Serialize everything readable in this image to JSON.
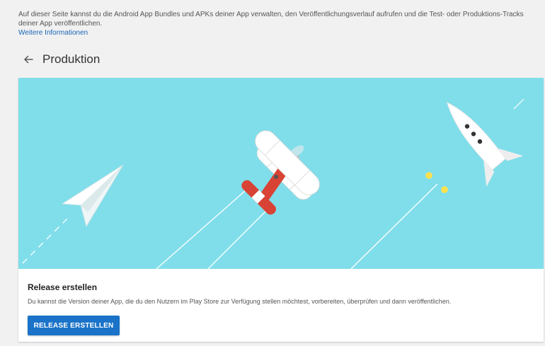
{
  "intro": {
    "text": "Auf dieser Seite kannst du die Android App Bundles und APKs deiner App verwalten, den Veröffentlichungsverlauf aufrufen und die Test- oder Produktions-Tracks deiner App veröffentlichen.",
    "link_label": "Weitere Informationen"
  },
  "header": {
    "back_icon": "arrow-left-icon",
    "title": "Produktion"
  },
  "card": {
    "illustration_icons": [
      "paper-plane-icon",
      "biplane-icon",
      "rocket-icon"
    ],
    "title": "Release erstellen",
    "description": "Du kannst die Version deiner App, die du den Nutzern im Play Store zur Verfügung stellen möchtest, vorbereiten, überprüfen und dann veröffentlichen.",
    "button_label": "RELEASE ERSTELLEN"
  },
  "colors": {
    "page_bg": "#f1f1f1",
    "banner_bg": "#80deea",
    "primary_button": "#1a73c8",
    "link": "#1a66b8",
    "plane_red": "#d84335"
  }
}
